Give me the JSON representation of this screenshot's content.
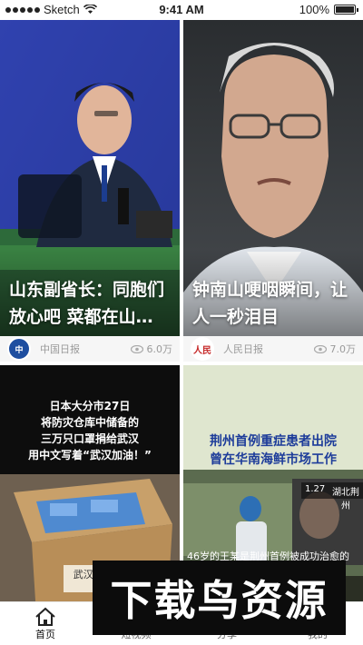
{
  "status_bar": {
    "carrier": "Sketch",
    "time": "9:41 AM",
    "battery": "100%"
  },
  "feed": [
    {
      "caption": "山东副省长：同胞们放心吧 菜都在山…",
      "source": "中国日报",
      "source_logo_text": "中国日报",
      "views": "6.0万"
    },
    {
      "caption": "钟南山哽咽瞬间，让人一秒泪目",
      "source": "人民日报",
      "source_logo_text": "人民日报",
      "views": "7.0万"
    },
    {
      "overlay_text": "日本大分市27日\n将防灾仓库中储备的\n三万只口罩捐给武汉\n用中文写着“武汉加油！”",
      "box_text": "武汉 加油！"
    },
    {
      "headline_overlay": "荆州首例重症患者出院\n曾在华南海鲜市场工作",
      "date_tag": "1.27",
      "location_tag": "湖北荆州",
      "subtitle": "46岁的王某是荆州首例被成功治愈的"
    }
  ],
  "tabbar": {
    "tabs": [
      {
        "label": "首页",
        "icon": "home-icon",
        "active": true
      },
      {
        "label": "短视频",
        "icon": "video-icon",
        "active": false
      },
      {
        "label": "分享",
        "icon": "share-icon",
        "active": false
      },
      {
        "label": "我的",
        "icon": "profile-icon",
        "active": false
      }
    ]
  },
  "watermark": "下载鸟资源"
}
